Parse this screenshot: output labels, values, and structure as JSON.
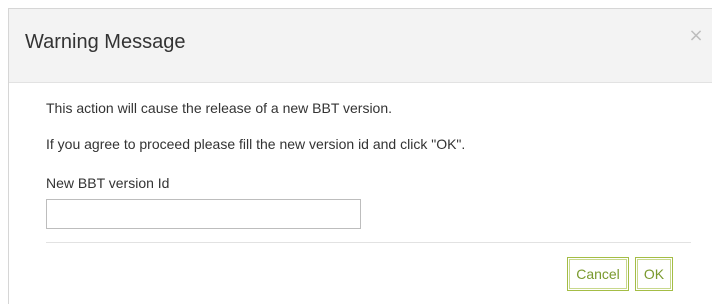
{
  "dialog": {
    "title": "Warning Message",
    "close_symbol": "×",
    "close_icon": "close-icon"
  },
  "body": {
    "message_line_1": "This action will cause the release of a new BBT version.",
    "message_line_2": "If you agree to proceed please fill the new version id and click \"OK\".",
    "field_label": "New BBT version Id",
    "field_value": "",
    "field_placeholder": ""
  },
  "footer": {
    "cancel_label": "Cancel",
    "ok_label": "OK"
  },
  "colors": {
    "header_background": "#f3f3f3",
    "button_border": "#a4bd45",
    "button_text": "#7a9a2e"
  }
}
